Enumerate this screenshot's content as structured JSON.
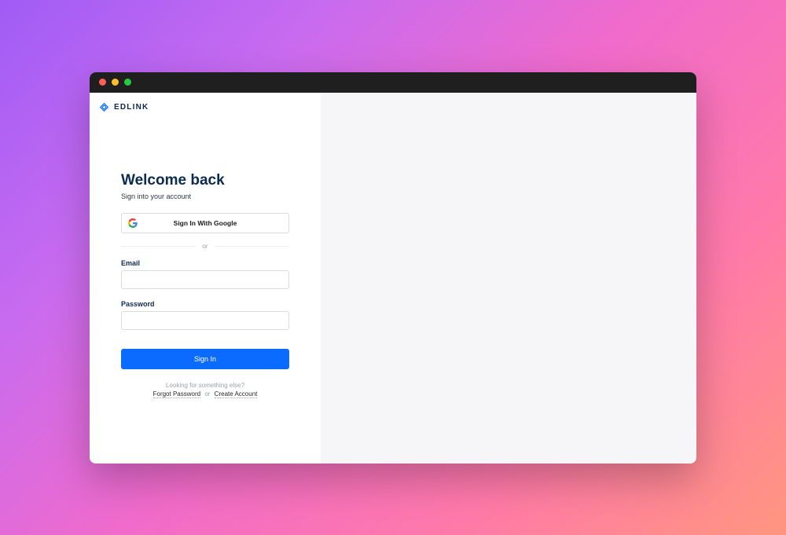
{
  "brand": {
    "name": "EDLINK"
  },
  "login": {
    "title": "Welcome back",
    "subtitle": "Sign into your account",
    "google_label": "Sign In With Google",
    "divider": "or",
    "email_label": "Email",
    "email_value": "",
    "password_label": "Password",
    "password_value": "",
    "signin_label": "Sign In"
  },
  "footer": {
    "prompt": "Looking for something else?",
    "forgot_password": "Forgot Password",
    "or": "or",
    "create_account": "Create Account"
  },
  "colors": {
    "primary": "#0b6bff",
    "text_dark": "#0b2b50"
  }
}
